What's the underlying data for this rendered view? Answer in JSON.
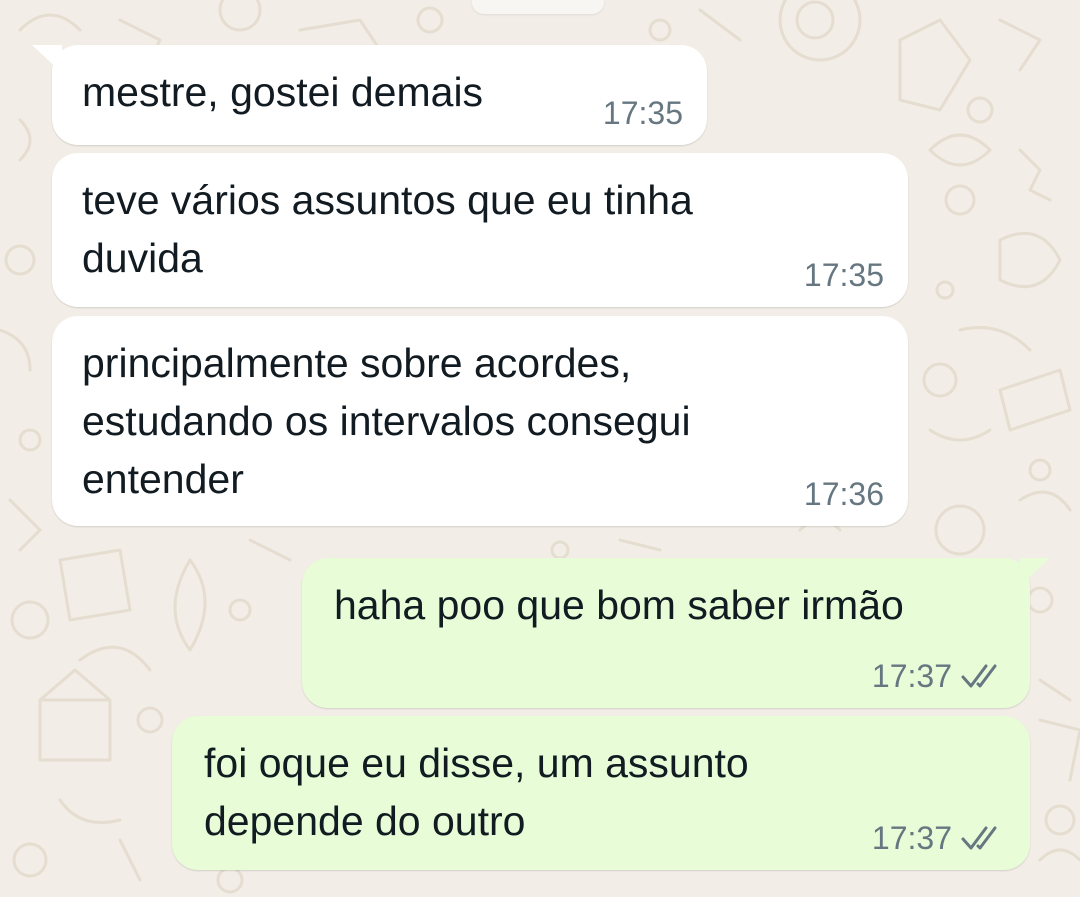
{
  "messages": [
    {
      "direction": "incoming",
      "text": "mestre, gostei demais",
      "time": "17:35"
    },
    {
      "direction": "incoming",
      "text": "teve vários assuntos que eu tinha\nduvida",
      "time": "17:35"
    },
    {
      "direction": "incoming",
      "text": "principalmente sobre acordes,\nestudando os intervalos consegui\nentender",
      "time": "17:36"
    },
    {
      "direction": "outgoing",
      "text": "haha poo que bom saber irmão",
      "time": "17:37",
      "status_icon": "double-check-icon"
    },
    {
      "direction": "outgoing",
      "text": "foi oque eu disse, um assunto\ndepende do outro",
      "time": "17:37",
      "status_icon": "double-check-icon"
    }
  ],
  "colors": {
    "wallpaper": "#f2ede6",
    "incoming_bubble": "#ffffff",
    "outgoing_bubble": "#e7fcd7",
    "text": "#111b21",
    "meta": "#667781"
  }
}
